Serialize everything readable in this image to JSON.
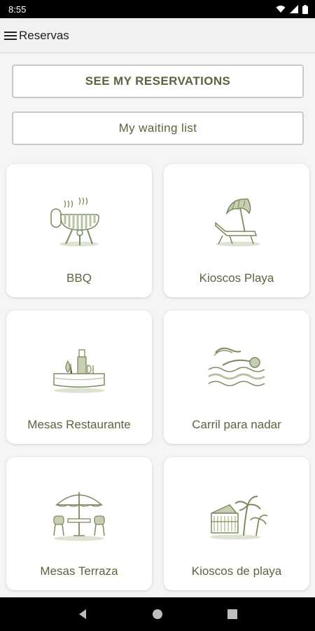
{
  "status_bar": {
    "time": "8:55",
    "icons": [
      "wifi-icon",
      "signal-icon",
      "battery-icon"
    ]
  },
  "app_bar": {
    "title": "Reservas",
    "menu_icon": "hamburger-menu-icon"
  },
  "buttons": {
    "see_reservations": "SEE MY RESERVATIONS",
    "waiting_list": "My waiting list"
  },
  "cards": [
    {
      "label": "BBQ",
      "icon": "bbq-grill-icon"
    },
    {
      "label": "Kioscos Playa",
      "icon": "beach-umbrella-lounger-icon"
    },
    {
      "label": "Mesas Restaurante",
      "icon": "restaurant-table-icon"
    },
    {
      "label": "Carril para nadar",
      "icon": "swimmer-icon"
    },
    {
      "label": "Mesas Terraza",
      "icon": "terrace-table-umbrella-icon"
    },
    {
      "label": "Kioscos de playa",
      "icon": "beach-kiosk-palm-icon"
    }
  ],
  "nav_bar": {
    "icons": [
      "back-icon",
      "home-icon",
      "recents-icon"
    ]
  },
  "colors": {
    "accent": "#59653e",
    "icon_tint": "#b8c3a4",
    "border": "#c9c9c9"
  }
}
